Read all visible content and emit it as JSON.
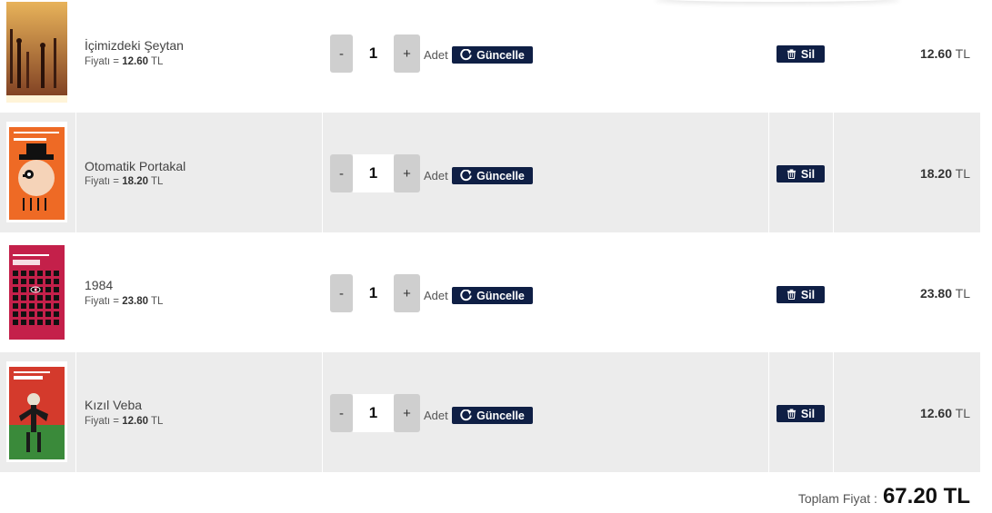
{
  "currency": "TL",
  "price_prefix": "Fiyatı =",
  "adet_label": "Adet",
  "update_label": "Güncelle",
  "delete_label": "Sil",
  "items": [
    {
      "title": "İçimizdeki Şeytan",
      "price": "12.60",
      "qty": "1",
      "line_total": "12.60",
      "cover_author": "SABAHATTİN ALİ",
      "cover_subtitle": "İçimizdeki Şeytan"
    },
    {
      "title": "Otomatik Portakal",
      "price": "18.20",
      "qty": "1",
      "line_total": "18.20",
      "cover_author": "ANTHONY BURGESS",
      "cover_subtitle": "OTOMATİK PORTAKAL"
    },
    {
      "title": "1984",
      "price": "23.80",
      "qty": "1",
      "line_total": "23.80",
      "cover_author": "GEORGE ORWELL",
      "cover_subtitle": "1984"
    },
    {
      "title": "Kızıl Veba",
      "price": "12.60",
      "qty": "1",
      "line_total": "12.60",
      "cover_author": "JACK LONDON",
      "cover_subtitle": "KIZIL VEBA"
    }
  ],
  "total": {
    "label": "Toplam Fiyat :",
    "amount": "67.20 TL"
  },
  "colors": {
    "button_bg": "#0f1f45",
    "row_alt_bg": "#ececec",
    "qty_btn_bg": "#cfcfcf"
  }
}
